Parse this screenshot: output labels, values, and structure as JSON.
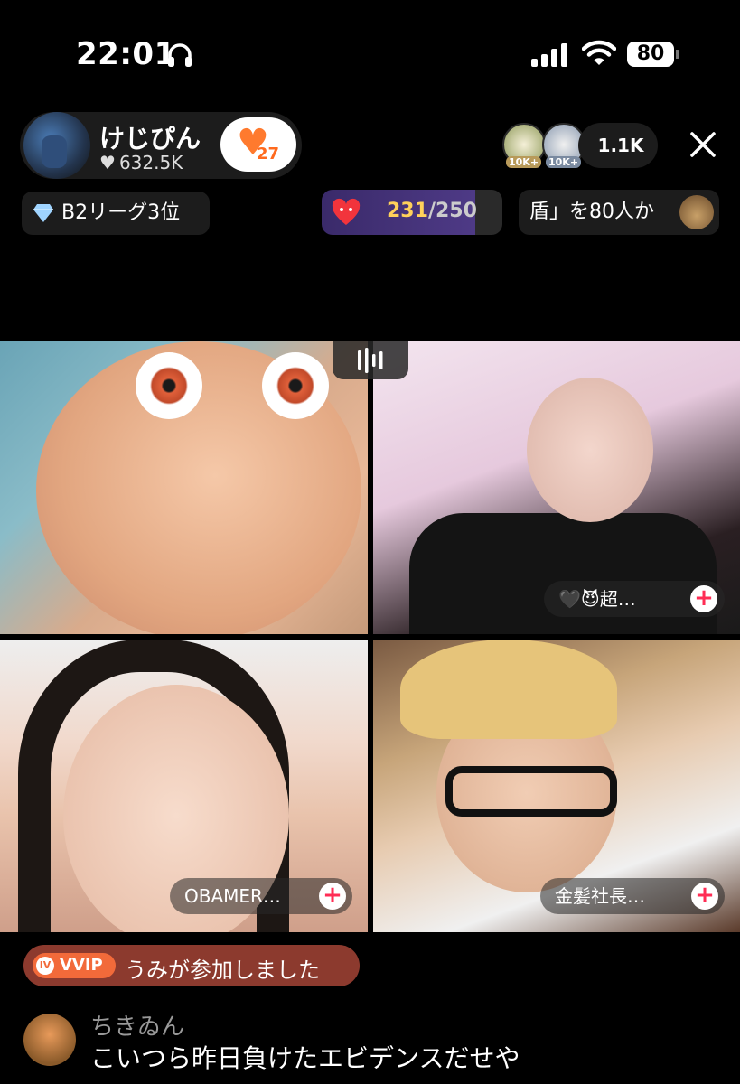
{
  "status_bar": {
    "time": "22:01",
    "battery": "80"
  },
  "host": {
    "name": "けじぴん",
    "likes": "632.5K",
    "fan_level": "27"
  },
  "viewers": {
    "badge_1": "10K+",
    "badge_2": "10K+",
    "count": "1.1K"
  },
  "badges": {
    "league": "B2リーグ3位",
    "goal_current": "231",
    "goal_total": "/250",
    "promo": "盾」を80人か"
  },
  "tiles": [
    {
      "name": ""
    },
    {
      "name": "🖤😈超…"
    },
    {
      "name": "OBAMER…"
    },
    {
      "name": "金髪社長…"
    }
  ],
  "comments": {
    "join_tag": "VVIP",
    "join_tag_icon": "IV",
    "join_text": "うみが参加しました",
    "user": "ちきゐん",
    "text": "こいつら昨日負けたエビデンスだせや"
  },
  "colors": {
    "background": "#000000",
    "plus_icon": "#ff2d55",
    "goal_value": "#ffd15a",
    "join_banner": "#8c3a2e"
  }
}
